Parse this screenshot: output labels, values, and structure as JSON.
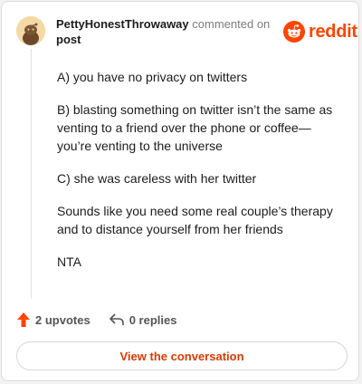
{
  "header": {
    "username": "PettyHonestThrowaway",
    "meta_text": "commented on",
    "post_link": "post",
    "brand": "reddit"
  },
  "comment": {
    "paragraphs": [
      "A) you have no privacy on twitters",
      "B) blasting something on twitter isn’t the same as venting to a friend over the phone or coffee—you’re venting to the universe",
      "C) she was careless with her twitter",
      "Sounds like you need some real couple’s therapy and to distance yourself from her friends",
      "NTA"
    ]
  },
  "footer": {
    "upvotes": "2 upvotes",
    "replies": "0 replies",
    "cta_label": "View the conversation"
  },
  "icons": {
    "avatar": "snoo-avatar-icon",
    "brand": "reddit-snoo-icon",
    "upvote": "upvote-arrow-icon",
    "reply": "reply-arrow-icon"
  },
  "colors": {
    "brand": "#ff4500",
    "upvote": "#ff4500",
    "cta_text": "#d93a00"
  }
}
